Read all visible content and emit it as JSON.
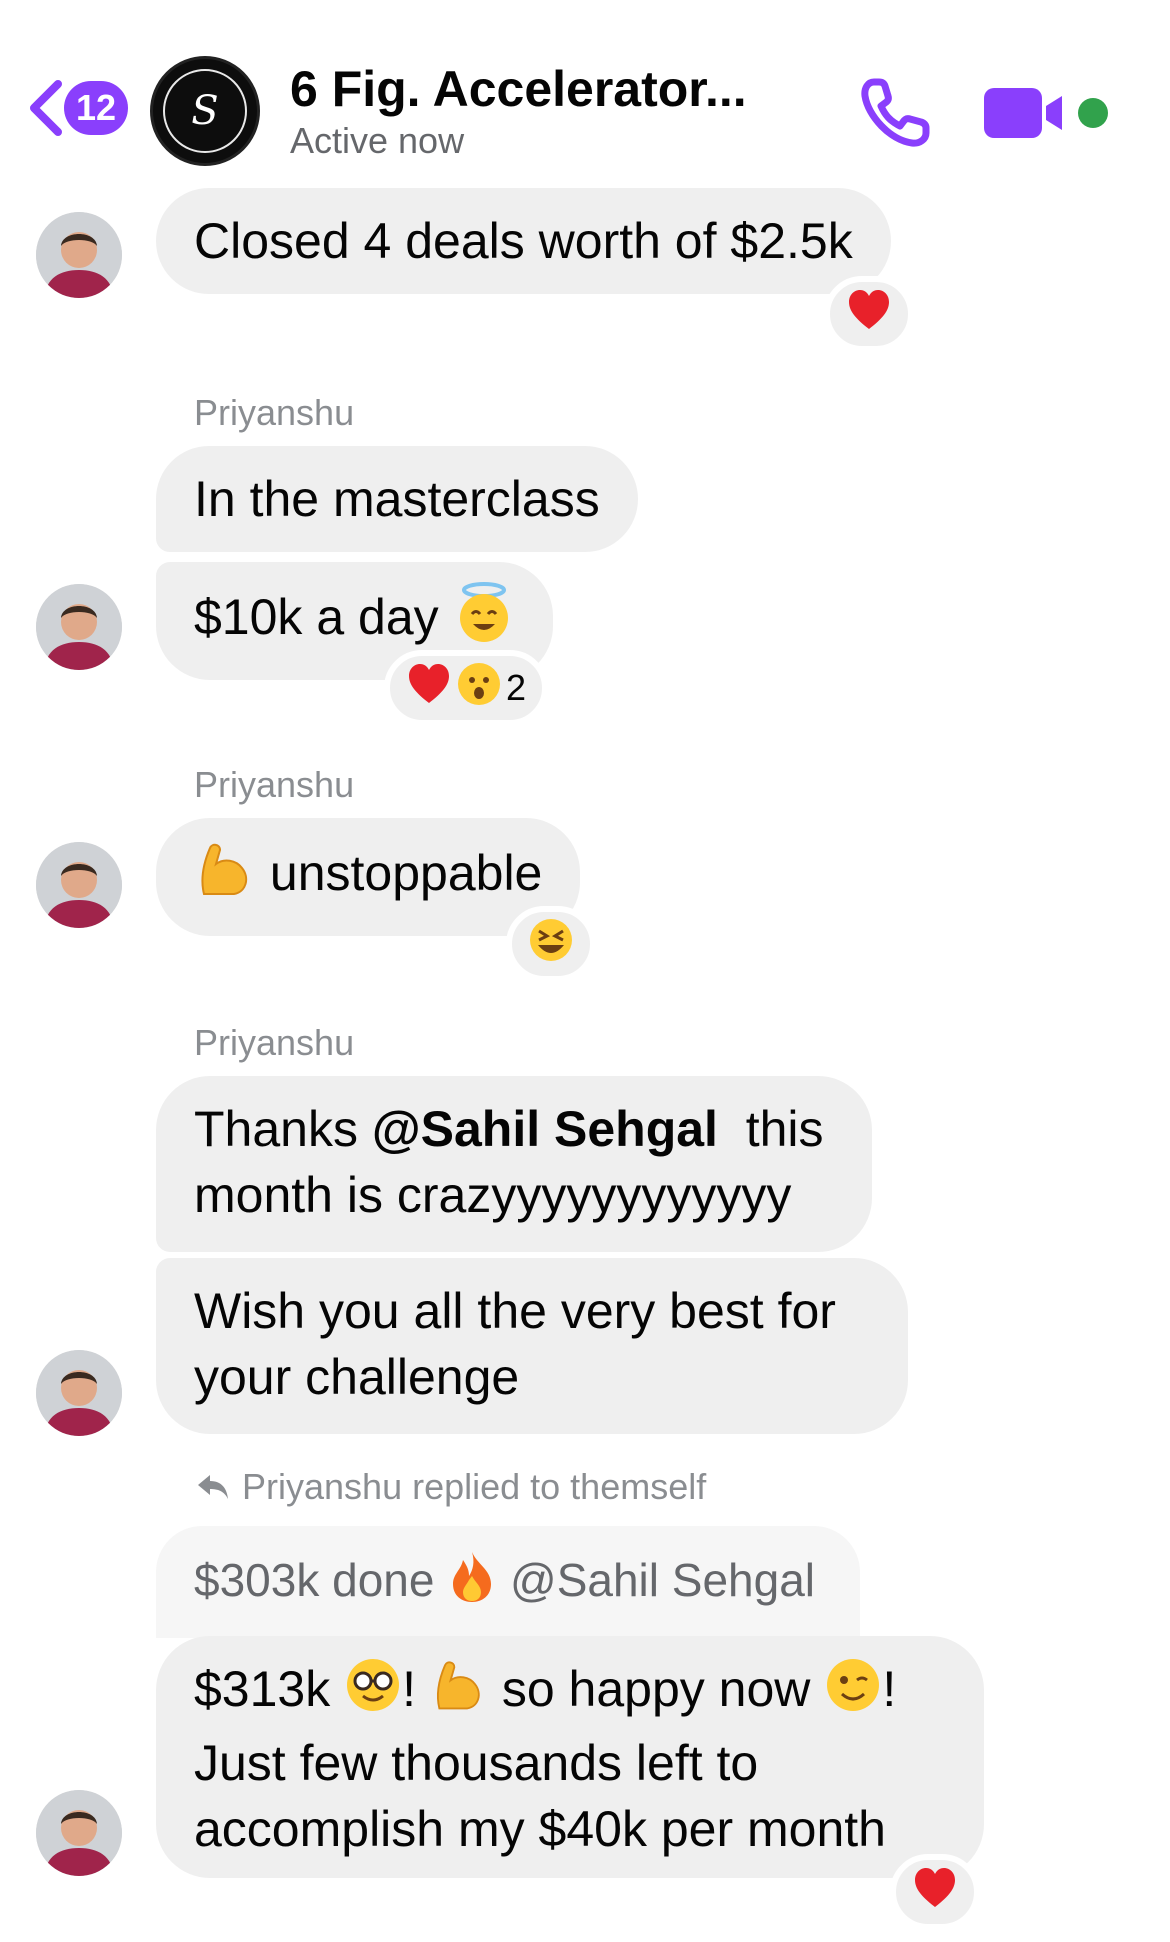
{
  "header": {
    "back_count": "12",
    "title": "6 Fig. Accelerator...",
    "status": "Active now",
    "group_avatar_mono": "S"
  },
  "colors": {
    "accent": "#8a3ffc",
    "bubble": "#efefef",
    "active": "#31a24c",
    "meta_text": "#8a8d91"
  },
  "messages": [
    {
      "text": "Closed 4 deals worth of $2.5k",
      "reactions": [
        "heart"
      ]
    },
    {
      "sender": "Priyanshu",
      "text": "In the masterclass"
    },
    {
      "text": "$10k a day",
      "emoji": "halo-face",
      "reactions": [
        "heart",
        "surprised-face"
      ],
      "reaction_count": "2"
    },
    {
      "sender": "Priyanshu",
      "emoji": "flexed-biceps",
      "text": "unstoppable",
      "reactions": [
        "grinning-squint-face"
      ]
    },
    {
      "sender": "Priyanshu",
      "prefix": "Thanks ",
      "mention": "@Sahil Sehgal",
      "suffix": "  this",
      "line2": "month is crazyyyyyyyyyyyy"
    },
    {
      "line1": "Wish you all the very best for",
      "line2": "your challenge"
    },
    {
      "reply_note": "Priyanshu replied to themself",
      "quoted_prefix": "$303k done",
      "quoted_mention": "@Sahil Sehgal",
      "line1_a": "$313k",
      "line1_b": "!",
      "line1_c": "so happy now",
      "line1_d": "!",
      "line2": "Just few thousands left to",
      "line3": "accomplish my $40k per month",
      "reactions": [
        "heart"
      ]
    }
  ]
}
